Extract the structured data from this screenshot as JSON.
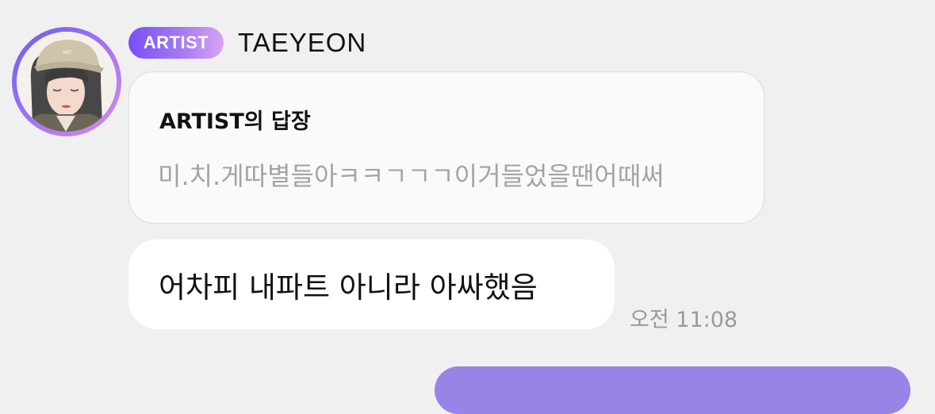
{
  "colors": {
    "background": "#f0f0f0",
    "accent": "#7a4ef5",
    "outgoing_bubble": "#9a83e6"
  },
  "sender": {
    "avatar_icon": "profile-photo",
    "badge_label": "ARTIST",
    "name": "TAEYEON"
  },
  "reply": {
    "title": "ARTIST의 답장",
    "quoted_text": "미.치.게따별들아ㅋㅋㄱㄱㄱ이거들었을땐어때써"
  },
  "message": {
    "text": "어차피 내파트 아니라 아싸했음",
    "time": "오전 11:08"
  }
}
